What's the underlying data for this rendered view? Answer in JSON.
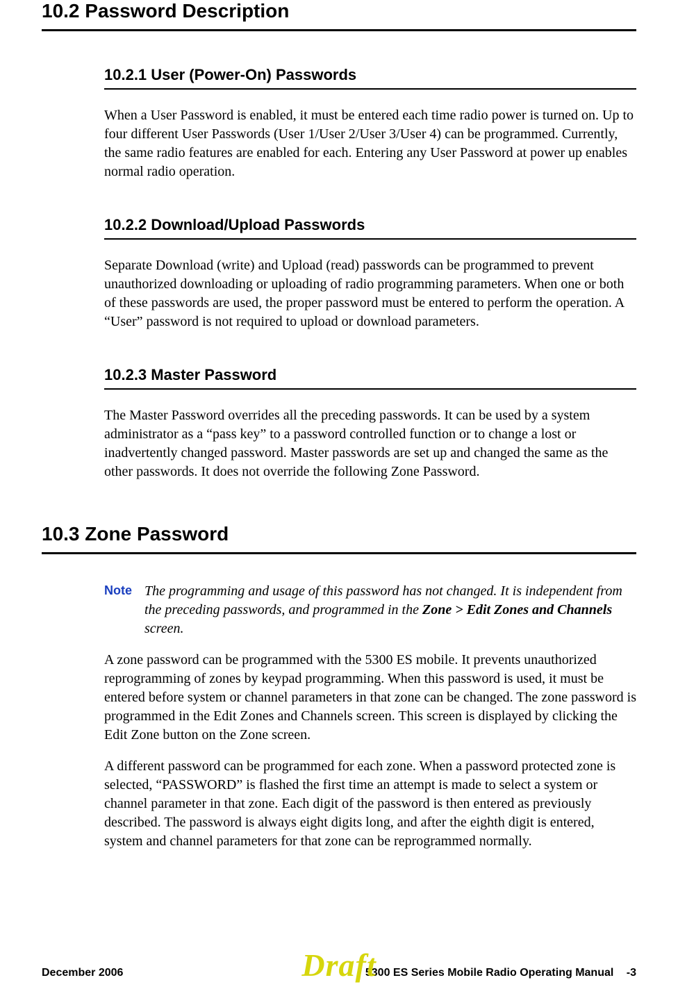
{
  "section_10_2": {
    "heading": "10.2    Password Description",
    "sub_10_2_1": {
      "heading": "10.2.1   User (Power-On) Passwords",
      "para": "When a User Password is enabled, it must be entered each time radio power is turned on. Up to four different User Passwords (User 1/User 2/User 3/User 4) can be programmed. Currently, the same radio features are enabled for each. Entering any User Password at power up enables normal radio operation."
    },
    "sub_10_2_2": {
      "heading": "10.2.2   Download/Upload Passwords",
      "para": "Separate Download (write) and Upload (read) passwords can be programmed to prevent unauthorized downloading or uploading of radio programming parameters. When one or both of these passwords are used, the proper password must be entered to perform the operation. A “User” password is not required to upload or download parameters."
    },
    "sub_10_2_3": {
      "heading": "10.2.3   Master Password",
      "para": "The Master Password overrides all the preceding passwords. It can be used by a system administrator as a “pass key” to a password controlled function or to change a lost or inadvertently changed password. Master passwords are set up and changed the same as the other passwords. It does not override the following Zone Password."
    }
  },
  "section_10_3": {
    "heading": "10.3    Zone Password",
    "note_label": "Note",
    "note_text_pre": "The programming and usage of this password has not changed. It is independent from the preceding passwords, and programmed in the ",
    "note_text_bold": "Zone > Edit Zones and Channels",
    "note_text_post": " screen.",
    "para1": "A zone password can be programmed with the 5300 ES mobile. It prevents unauthorized reprogramming of zones by keypad programming. When this password is used, it must be entered before system or channel parameters in that zone can be changed. The zone password is programmed in the Edit Zones and Channels screen. This screen is displayed by clicking the Edit Zone button on the Zone screen.",
    "para2": "A different password can be programmed for each zone. When a password protected zone is selected, “PASSWORD” is flashed the first time an attempt is made to select a system or channel parameter in that zone. Each digit of the password is then entered as previously described. The password is always eight digits long, and after the eighth digit is entered, system and channel parameters for that zone can be reprogrammed normally."
  },
  "footer": {
    "left": "December 2006",
    "center": "Draft",
    "right_title": "5300 ES Series Mobile Radio Operating Manual",
    "right_page": "-3"
  }
}
